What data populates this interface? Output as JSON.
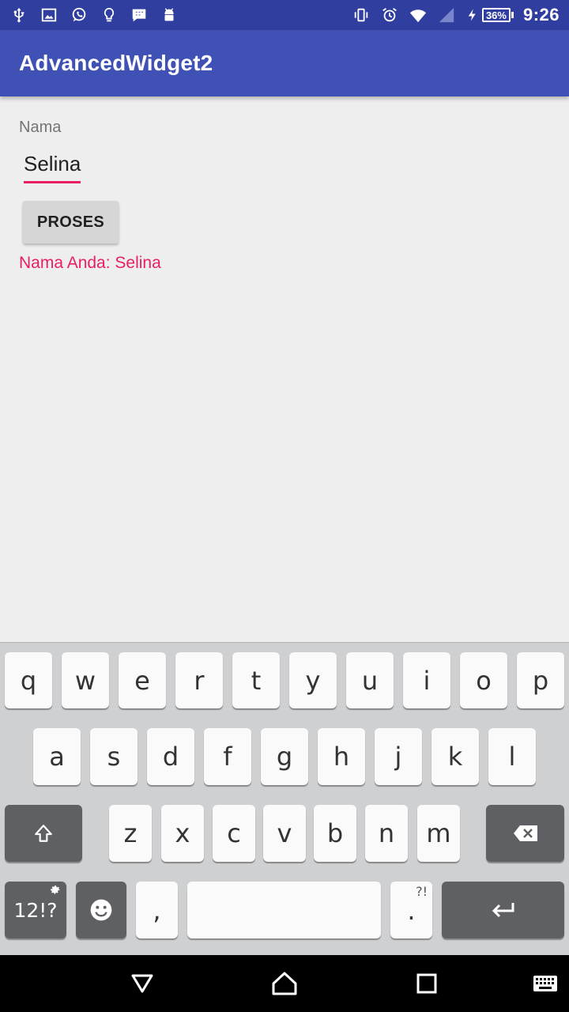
{
  "status_bar": {
    "time": "9:26",
    "battery_percent": "36%",
    "left_icons": [
      "usb-icon",
      "image-icon",
      "whatsapp-icon",
      "lightbulb-icon",
      "bbm-icon",
      "android-icon"
    ],
    "right_icons": [
      "vibrate-icon",
      "alarm-icon",
      "wifi-icon",
      "signal-icon",
      "charging-icon",
      "battery-icon"
    ]
  },
  "app_bar": {
    "title": "AdvancedWidget2"
  },
  "form": {
    "name_label": "Nama",
    "name_value": "Selina",
    "submit_label": "PROSES",
    "result": "Nama Anda: Selina"
  },
  "keyboard": {
    "row1": [
      "q",
      "w",
      "e",
      "r",
      "t",
      "y",
      "u",
      "i",
      "o",
      "p"
    ],
    "row2": [
      "a",
      "s",
      "d",
      "f",
      "g",
      "h",
      "j",
      "k",
      "l"
    ],
    "row3": [
      "z",
      "x",
      "c",
      "v",
      "b",
      "n",
      "m"
    ],
    "symbols_label": "12!?",
    "comma_label": ",",
    "period_label": ".",
    "period_hint": "?!"
  },
  "colors": {
    "status_bar": "#303f9f",
    "app_bar": "#3f51b5",
    "accent": "#e91e63",
    "background": "#eeeeee"
  }
}
